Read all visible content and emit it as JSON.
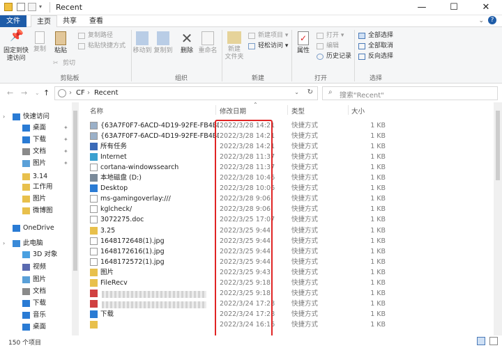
{
  "window": {
    "title": "Recent",
    "min": "—",
    "max": "☐",
    "close": "✕"
  },
  "menu": {
    "file": "文件",
    "home": "主页",
    "share": "共享",
    "view": "查看"
  },
  "ribbon": {
    "pin": "固定到快\n速访问",
    "copy": "复制",
    "paste": "粘贴",
    "copy_path": "复制路径",
    "paste_shortcut": "粘贴快捷方式",
    "cut": "剪切",
    "move_to": "移动到",
    "copy_to": "复制到",
    "delete": "删除",
    "rename": "重命名",
    "new_folder": "新建\n文件夹",
    "new_item": "新建项目",
    "easy_access": "轻松访问",
    "properties": "属性",
    "open": "打开",
    "edit": "编辑",
    "history": "历史记录",
    "select_all": "全部选择",
    "select_none": "全部取消",
    "invert": "反向选择",
    "g_clipboard": "剪贴板",
    "g_organize": "组织",
    "g_new": "新建",
    "g_open": "打开",
    "g_select": "选择"
  },
  "address": {
    "path1": "CF",
    "path2": "Recent",
    "search_placeholder": "搜索\"Recent\""
  },
  "nav": [
    {
      "label": "快速访问",
      "icon": "star-icon"
    },
    {
      "label": "桌面",
      "icon": "desktop-icon"
    },
    {
      "label": "下载",
      "icon": "download-icon"
    },
    {
      "label": "文档",
      "icon": "document-icon"
    },
    {
      "label": "图片",
      "icon": "picture-icon"
    },
    {
      "label": "3.14",
      "icon": "folder-icon"
    },
    {
      "label": "工作用",
      "icon": "folder-icon"
    },
    {
      "label": "图片",
      "icon": "folder-icon"
    },
    {
      "label": "微博图",
      "icon": "folder-icon"
    },
    {
      "label": "OneDrive",
      "icon": "cloud-icon"
    },
    {
      "label": "此电脑",
      "icon": "computer-icon"
    },
    {
      "label": "3D 对象",
      "icon": "cube-icon"
    },
    {
      "label": "视频",
      "icon": "video-icon"
    },
    {
      "label": "图片",
      "icon": "picture-icon"
    },
    {
      "label": "文档",
      "icon": "document-icon"
    },
    {
      "label": "下载",
      "icon": "download-icon"
    },
    {
      "label": "音乐",
      "icon": "music-icon"
    },
    {
      "label": "桌面",
      "icon": "desktop-icon"
    }
  ],
  "columns": {
    "name": "名称",
    "date": "修改日期",
    "type": "类型",
    "size": "大小"
  },
  "files": [
    {
      "name": "{63A7F0F7-6ACD-4D19-92FE-FB4BD9...",
      "date": "2022/3/28 14:21",
      "type": "快捷方式",
      "size": "1 KB",
      "icon": "shortcut-icon"
    },
    {
      "name": "{63A7F0F7-6ACD-4D19-92FE-FB4BD9...",
      "date": "2022/3/28 14:21",
      "type": "快捷方式",
      "size": "1 KB",
      "icon": "shortcut-icon"
    },
    {
      "name": "所有任务",
      "date": "2022/3/28 14:21",
      "type": "快捷方式",
      "size": "1 KB",
      "icon": "control-panel-icon"
    },
    {
      "name": "Internet",
      "date": "2022/3/28 11:37",
      "type": "快捷方式",
      "size": "1 KB",
      "icon": "internet-icon"
    },
    {
      "name": "cortana-windowssearch",
      "date": "2022/3/28 11:37",
      "type": "快捷方式",
      "size": "1 KB",
      "icon": "file-icon"
    },
    {
      "name": "本地磁盘 (D:)",
      "date": "2022/3/28 10:46",
      "type": "快捷方式",
      "size": "1 KB",
      "icon": "drive-icon"
    },
    {
      "name": "Desktop",
      "date": "2022/3/28 10:06",
      "type": "快捷方式",
      "size": "1 KB",
      "icon": "desktop-icon"
    },
    {
      "name": "ms-gamingoverlay:///",
      "date": "2022/3/28 9:06",
      "type": "快捷方式",
      "size": "1 KB",
      "icon": "file-icon"
    },
    {
      "name": "kglcheck/",
      "date": "2022/3/28 9:06",
      "type": "快捷方式",
      "size": "1 KB",
      "icon": "file-icon"
    },
    {
      "name": "3072275.doc",
      "date": "2022/3/25 17:07",
      "type": "快捷方式",
      "size": "1 KB",
      "icon": "doc-icon"
    },
    {
      "name": "3.25",
      "date": "2022/3/25 9:44",
      "type": "快捷方式",
      "size": "1 KB",
      "icon": "folder-icon"
    },
    {
      "name": "1648172648(1).jpg",
      "date": "2022/3/25 9:44",
      "type": "快捷方式",
      "size": "1 KB",
      "icon": "file-icon"
    },
    {
      "name": "1648172616(1).jpg",
      "date": "2022/3/25 9:44",
      "type": "快捷方式",
      "size": "1 KB",
      "icon": "file-icon"
    },
    {
      "name": "1648172572(1).jpg",
      "date": "2022/3/25 9:44",
      "type": "快捷方式",
      "size": "1 KB",
      "icon": "file-icon"
    },
    {
      "name": "图片",
      "date": "2022/3/25 9:43",
      "type": "快捷方式",
      "size": "1 KB",
      "icon": "folder-icon"
    },
    {
      "name": "FileRecv",
      "date": "2022/3/25 9:18",
      "type": "快捷方式",
      "size": "1 KB",
      "icon": "folder-icon"
    },
    {
      "name": "",
      "date": "2022/3/25 9:18",
      "type": "快捷方式",
      "size": "1 KB",
      "icon": "image-icon"
    },
    {
      "name": "",
      "date": "2022/3/24 17:28",
      "type": "快捷方式",
      "size": "1 KB",
      "icon": "image-icon"
    },
    {
      "name": "下载",
      "date": "2022/3/24 17:28",
      "type": "快捷方式",
      "size": "1 KB",
      "icon": "download-icon"
    },
    {
      "name": "",
      "date": "2022/3/24 16:16",
      "type": "快捷方式",
      "size": "1 KB",
      "icon": "folder-icon"
    }
  ],
  "status": {
    "count": "150 个项目"
  },
  "colors": {
    "accent": "#1e5ca8",
    "highlight": "#e02424"
  }
}
